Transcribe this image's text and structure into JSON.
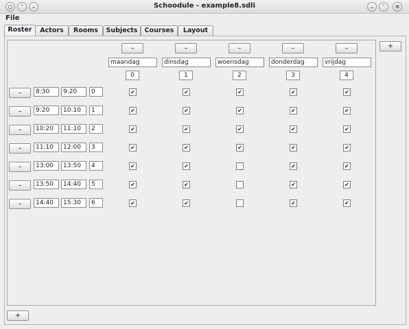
{
  "window": {
    "title": "Schoodule - example8.sdli",
    "controls_left": [
      "○",
      "⌃",
      "⌄"
    ],
    "controls_right": [
      "⌄",
      "⌃",
      "⊗"
    ]
  },
  "menu": {
    "file": "File"
  },
  "tabs": [
    "Roster",
    "Actors",
    "Rooms",
    "Subjects",
    "Courses",
    "Layout"
  ],
  "active_tab": "Roster",
  "roster": {
    "minus_label": "–",
    "plus_label": "+",
    "days": [
      {
        "name": "maandag",
        "index": "0"
      },
      {
        "name": "dinsdag",
        "index": "1"
      },
      {
        "name": "woensdag",
        "index": "2"
      },
      {
        "name": "donderdag",
        "index": "3"
      },
      {
        "name": "vrijdag",
        "index": "4"
      }
    ],
    "slots": [
      {
        "start": "8:30",
        "end": "9:20",
        "index": "0",
        "checks": [
          true,
          true,
          true,
          true,
          true
        ]
      },
      {
        "start": "9:20",
        "end": "10:10",
        "index": "1",
        "checks": [
          true,
          true,
          true,
          true,
          true
        ]
      },
      {
        "start": "10:20",
        "end": "11:10",
        "index": "2",
        "checks": [
          true,
          true,
          true,
          true,
          true
        ]
      },
      {
        "start": "11:10",
        "end": "12:00",
        "index": "3",
        "checks": [
          true,
          true,
          true,
          true,
          true
        ]
      },
      {
        "start": "13:00",
        "end": "13:50",
        "index": "4",
        "checks": [
          true,
          true,
          false,
          true,
          true
        ]
      },
      {
        "start": "13:50",
        "end": "14:40",
        "index": "5",
        "checks": [
          true,
          true,
          false,
          true,
          true
        ]
      },
      {
        "start": "14:40",
        "end": "15:30",
        "index": "6",
        "checks": [
          true,
          true,
          false,
          true,
          true
        ]
      }
    ],
    "check_glyph": "✔"
  }
}
